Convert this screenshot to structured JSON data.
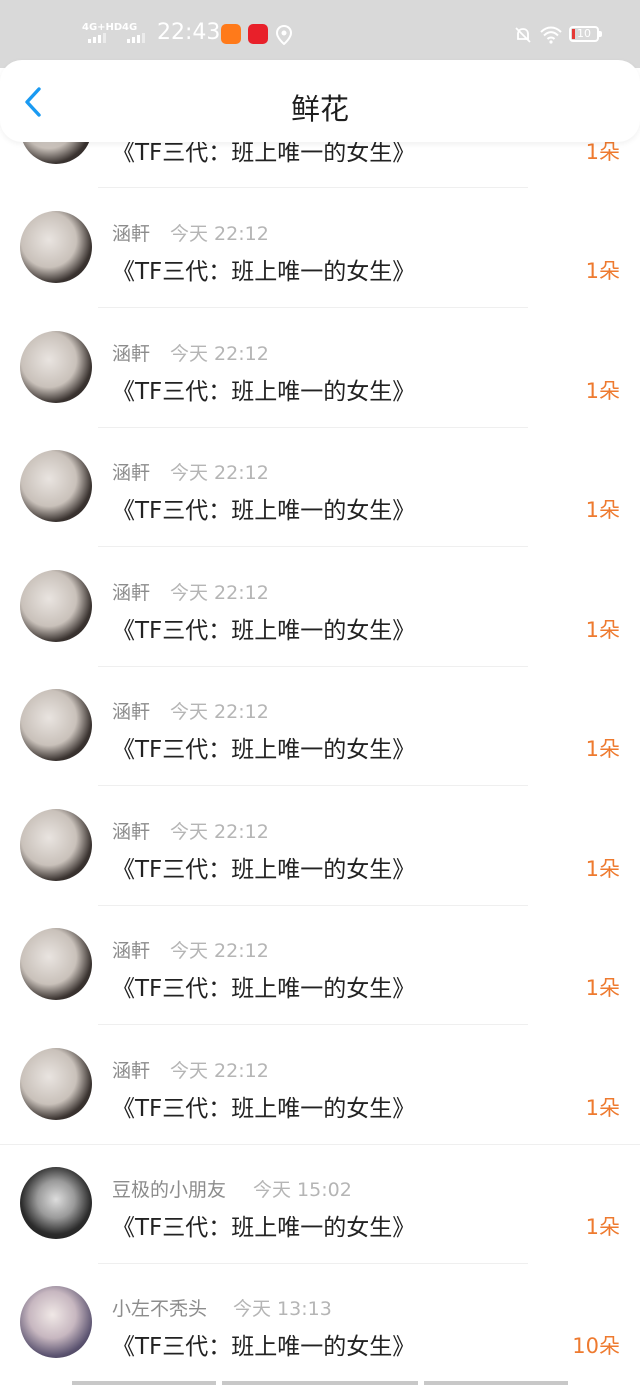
{
  "status_bar": {
    "network_1": "4G+HD",
    "network_2": "4G",
    "time": "22:43",
    "battery": "10"
  },
  "header": {
    "title": "鲜花"
  },
  "partial_row": {
    "title": "《TF三代：班上唯一的女生》",
    "count": "1朵"
  },
  "gifts": [
    {
      "name": "涵軒",
      "time": "今天 22:12",
      "title": "《TF三代：班上唯一的女生》",
      "count": "1朵"
    },
    {
      "name": "涵軒",
      "time": "今天 22:12",
      "title": "《TF三代：班上唯一的女生》",
      "count": "1朵"
    },
    {
      "name": "涵軒",
      "time": "今天 22:12",
      "title": "《TF三代：班上唯一的女生》",
      "count": "1朵"
    },
    {
      "name": "涵軒",
      "time": "今天 22:12",
      "title": "《TF三代：班上唯一的女生》",
      "count": "1朵"
    },
    {
      "name": "涵軒",
      "time": "今天 22:12",
      "title": "《TF三代：班上唯一的女生》",
      "count": "1朵"
    },
    {
      "name": "涵軒",
      "time": "今天 22:12",
      "title": "《TF三代：班上唯一的女生》",
      "count": "1朵"
    },
    {
      "name": "涵軒",
      "time": "今天 22:12",
      "title": "《TF三代：班上唯一的女生》",
      "count": "1朵"
    },
    {
      "name": "涵軒",
      "time": "今天 22:12",
      "title": "《TF三代：班上唯一的女生》",
      "count": "1朵"
    },
    {
      "name": "豆极的小朋友",
      "time": "今天 15:02",
      "title": "《TF三代：班上唯一的女生》",
      "count": "1朵"
    },
    {
      "name": "小左不秃头",
      "time": "今天 13:13",
      "title": "《TF三代：班上唯一的女生》",
      "count": "10朵"
    }
  ],
  "colors": {
    "accent": "#1a9af2",
    "count": "#ee7a2f",
    "status_bar_bg": "#d9d9d9"
  }
}
